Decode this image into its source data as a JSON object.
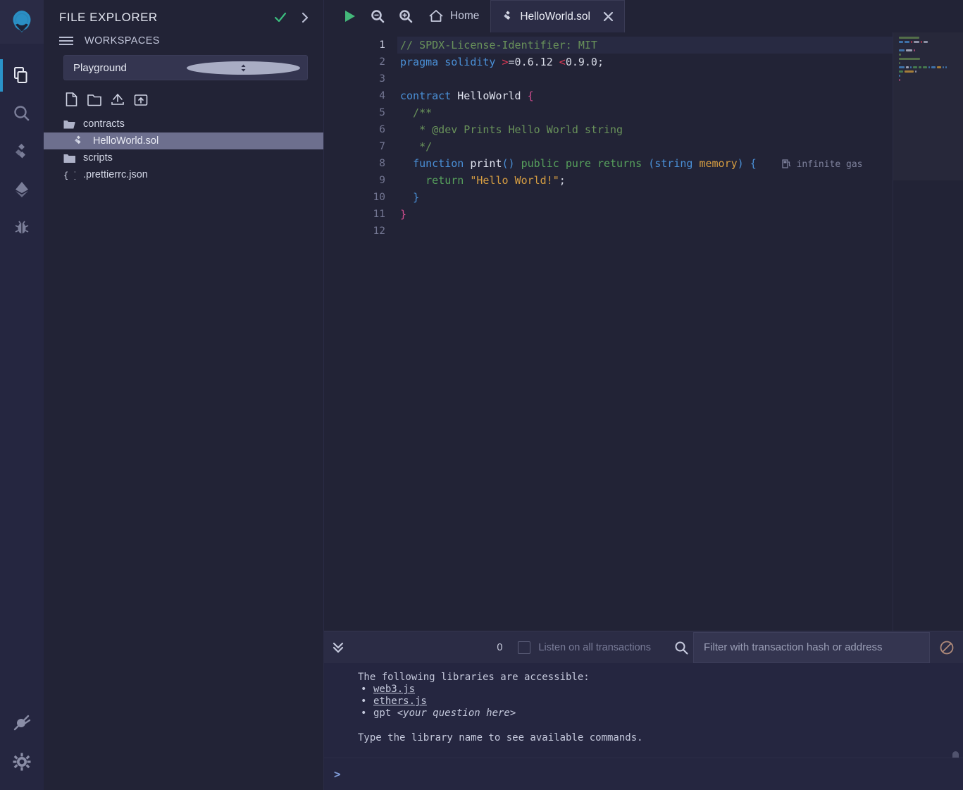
{
  "app": {
    "name": "Remix IDE",
    "logo_icon": "remix-logo-icon"
  },
  "rail": {
    "items": [
      {
        "name": "file-explorer",
        "icon": "files-icon",
        "active": true
      },
      {
        "name": "search",
        "icon": "search-icon",
        "active": false
      },
      {
        "name": "solidity-compiler",
        "icon": "solidity-icon",
        "active": false
      },
      {
        "name": "deploy-run",
        "icon": "ethereum-icon",
        "active": false
      },
      {
        "name": "debugger",
        "icon": "bug-icon",
        "active": false
      }
    ],
    "bottom": [
      {
        "name": "plugin-manager",
        "icon": "plug-icon"
      },
      {
        "name": "settings",
        "icon": "gear-icon"
      }
    ]
  },
  "explorer": {
    "title": "FILE EXPLORER",
    "header_icons": [
      {
        "name": "checkmark-icon",
        "color": "#3bbd7e"
      },
      {
        "name": "chevron-right-icon",
        "color": "#b9bdd2"
      }
    ],
    "workspaces_label": "WORKSPACES",
    "burger_icon": "hamburger-icon",
    "workspace_selected": "Playground",
    "workspace_caret_icon": "sort-updown-icon",
    "actions": [
      {
        "name": "new-file-button",
        "icon": "new-file-icon"
      },
      {
        "name": "new-folder-button",
        "icon": "new-folder-icon"
      },
      {
        "name": "upload-file-button",
        "icon": "upload-file-icon"
      },
      {
        "name": "upload-folder-button",
        "icon": "upload-folder-icon"
      }
    ],
    "tree": [
      {
        "label": "contracts",
        "icon": "folder-open-icon",
        "type": "folder",
        "depth": 0,
        "selected": false
      },
      {
        "label": "HelloWorld.sol",
        "icon": "solidity-file-icon",
        "type": "file",
        "depth": 1,
        "selected": true
      },
      {
        "label": "scripts",
        "icon": "folder-icon",
        "type": "folder",
        "depth": 0,
        "selected": false
      },
      {
        "label": ".prettierrc.json",
        "icon": "json-file-icon",
        "type": "file",
        "depth": 0,
        "selected": false
      }
    ]
  },
  "tabbar": {
    "run_icon": "play-icon",
    "zoom_out_icon": "zoom-out-icon",
    "zoom_in_icon": "zoom-in-icon",
    "home_icon": "home-icon",
    "home_label": "Home",
    "active_tab": {
      "label": "HelloWorld.sol",
      "icon": "solidity-file-icon",
      "close_icon": "close-icon"
    }
  },
  "editor": {
    "line_numbers": [
      "1",
      "2",
      "3",
      "4",
      "5",
      "6",
      "7",
      "8",
      "9",
      "10",
      "11",
      "12"
    ],
    "current_line": 1,
    "gas_annotation": "infinite gas",
    "gas_icon": "fuel-pump-icon",
    "lines": [
      {
        "n": 1,
        "tokens": [
          {
            "t": "// SPDX-License-Identifier: MIT",
            "c": "c-com"
          }
        ]
      },
      {
        "n": 2,
        "tokens": [
          {
            "t": "pragma",
            "c": "c-key"
          },
          {
            "t": " ",
            "c": "c-pln"
          },
          {
            "t": "solidity",
            "c": "c-key"
          },
          {
            "t": " ",
            "c": "c-pln"
          },
          {
            "t": ">",
            "c": "c-op"
          },
          {
            "t": "=0.6.12 ",
            "c": "c-num"
          },
          {
            "t": "<",
            "c": "c-op"
          },
          {
            "t": "0.9.0;",
            "c": "c-num"
          }
        ]
      },
      {
        "n": 3,
        "tokens": []
      },
      {
        "n": 4,
        "tokens": [
          {
            "t": "contract",
            "c": "c-key"
          },
          {
            "t": " ",
            "c": "c-pln"
          },
          {
            "t": "HelloWorld",
            "c": "c-fn"
          },
          {
            "t": " ",
            "c": "c-pln"
          },
          {
            "t": "{",
            "c": "c-brc2"
          }
        ]
      },
      {
        "n": 5,
        "tokens": [
          {
            "t": "  /**",
            "c": "c-com"
          }
        ]
      },
      {
        "n": 6,
        "tokens": [
          {
            "t": "   * @dev Prints Hello World string",
            "c": "c-com"
          }
        ]
      },
      {
        "n": 7,
        "tokens": [
          {
            "t": "   */",
            "c": "c-com"
          }
        ]
      },
      {
        "n": 8,
        "tokens": [
          {
            "t": "  ",
            "c": "c-pln"
          },
          {
            "t": "function",
            "c": "c-key"
          },
          {
            "t": " ",
            "c": "c-pln"
          },
          {
            "t": "print",
            "c": "c-fn"
          },
          {
            "t": "()",
            "c": "c-brc"
          },
          {
            "t": " ",
            "c": "c-pln"
          },
          {
            "t": "public",
            "c": "c-mod"
          },
          {
            "t": " ",
            "c": "c-pln"
          },
          {
            "t": "pure",
            "c": "c-mod"
          },
          {
            "t": " ",
            "c": "c-pln"
          },
          {
            "t": "returns",
            "c": "c-mod"
          },
          {
            "t": " ",
            "c": "c-pln"
          },
          {
            "t": "(",
            "c": "c-brc"
          },
          {
            "t": "string",
            "c": "c-type"
          },
          {
            "t": " ",
            "c": "c-pln"
          },
          {
            "t": "memory",
            "c": "c-var"
          },
          {
            "t": ")",
            "c": "c-brc"
          },
          {
            "t": " ",
            "c": "c-pln"
          },
          {
            "t": "{",
            "c": "c-brc"
          }
        ]
      },
      {
        "n": 9,
        "tokens": [
          {
            "t": "    ",
            "c": "c-pln"
          },
          {
            "t": "return",
            "c": "c-mod"
          },
          {
            "t": " ",
            "c": "c-pln"
          },
          {
            "t": "\"Hello World!\"",
            "c": "c-str"
          },
          {
            "t": ";",
            "c": "c-pln"
          }
        ]
      },
      {
        "n": 10,
        "tokens": [
          {
            "t": "  ",
            "c": "c-pln"
          },
          {
            "t": "}",
            "c": "c-brc"
          }
        ]
      },
      {
        "n": 11,
        "tokens": [
          {
            "t": "}",
            "c": "c-brc2"
          }
        ]
      },
      {
        "n": 12,
        "tokens": []
      }
    ]
  },
  "terminal": {
    "collapse_icon": "double-chevron-down-icon",
    "tx_count": "0",
    "listen_label": "Listen on all transactions",
    "listen_checked": false,
    "search_icon": "search-icon",
    "filter_placeholder": "Filter with transaction hash or address",
    "filter_value": "",
    "clear_icon": "no-entry-icon",
    "output": {
      "intro": "The following libraries are accessible:",
      "libraries": [
        {
          "text": "web3.js",
          "link": true
        },
        {
          "text": "ethers.js",
          "link": true
        },
        {
          "text": "gpt ",
          "link": false,
          "italic_suffix": "<your question here>"
        }
      ],
      "hint": "Type the library name to see available commands."
    },
    "prompt_char": ">",
    "prompt_value": ""
  }
}
